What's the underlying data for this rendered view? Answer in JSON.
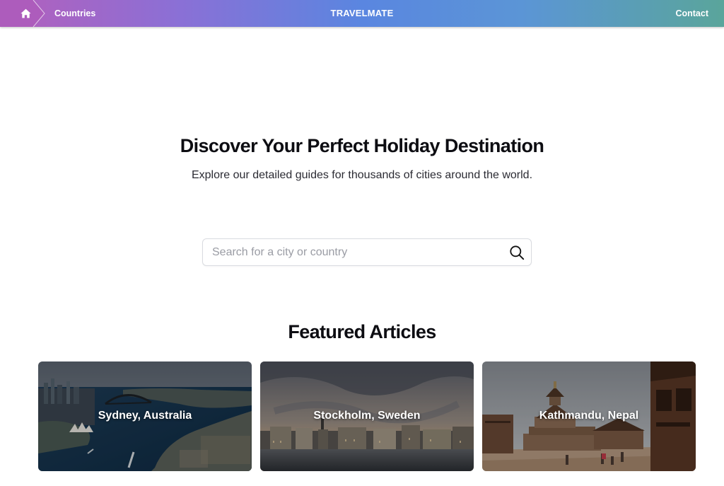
{
  "nav": {
    "breadcrumb_link": "Countries",
    "brand": "TRAVELMATE",
    "contact": "Contact"
  },
  "hero": {
    "title": "Discover Your Perfect Holiday Destination",
    "subtitle": "Explore our detailed guides for thousands of cities around the world."
  },
  "search": {
    "placeholder": "Search for a city or country",
    "value": ""
  },
  "featured": {
    "title": "Featured Articles",
    "articles": [
      {
        "label": "Sydney, Australia"
      },
      {
        "label": "Stockholm, Sweden"
      },
      {
        "label": "Kathmandu, Nepal"
      }
    ]
  },
  "icons": {
    "home": "home-icon",
    "search": "search-icon"
  },
  "colors": {
    "nav_gradient_start": "#b45fbc",
    "nav_gradient_mid": "#5a86e0",
    "nav_gradient_end": "#5aa59b",
    "text_dark": "#0d0d12",
    "placeholder": "#9a9ca4"
  }
}
